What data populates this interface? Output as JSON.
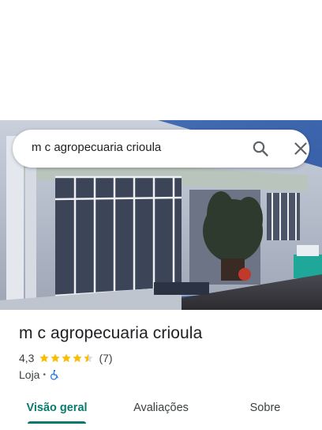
{
  "search": {
    "query": "m c agropecuaria crioula"
  },
  "place": {
    "name": "m c agropecuaria crioula",
    "rating": "4,3",
    "rating_value": 4.3,
    "review_count": "(7)",
    "type": "Loja",
    "separator": "•"
  },
  "tabs": [
    {
      "label": "Visão geral",
      "active": true
    },
    {
      "label": "Avaliações",
      "active": false
    },
    {
      "label": "Sobre",
      "active": false
    }
  ],
  "colors": {
    "accent": "#0b7a6e",
    "star": "#fbbc04",
    "accessibility_icon": "#1a73e8"
  },
  "icons": {
    "search": "search-icon",
    "close": "close-icon",
    "accessibility": "wheelchair-icon",
    "star": "star-icon"
  }
}
